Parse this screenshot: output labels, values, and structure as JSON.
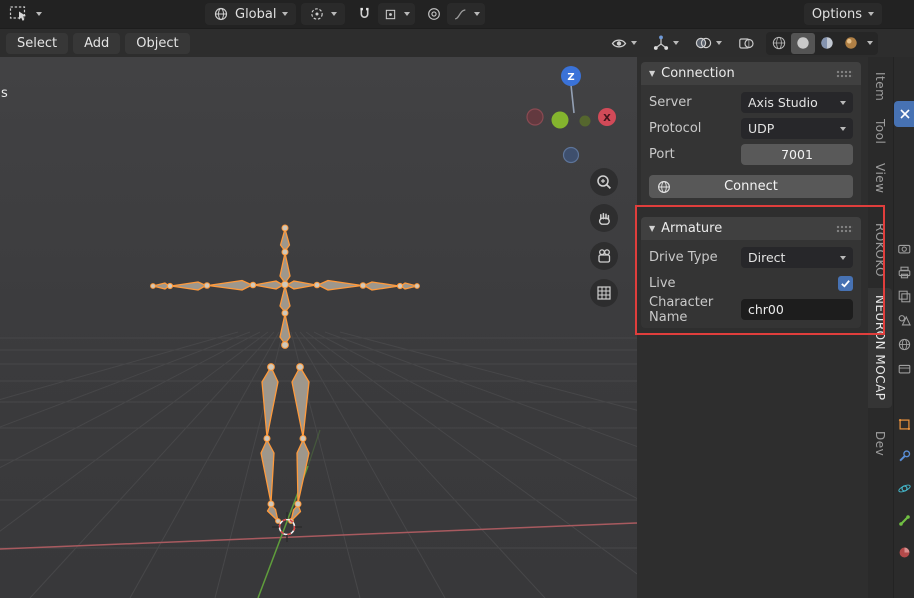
{
  "header": {
    "transform_orientation": "Global",
    "options": "Options"
  },
  "toolbar_menus": [
    "Select",
    "Add",
    "Object"
  ],
  "viewport": {
    "left_edge_label": "s",
    "gizmo_axis_z": "Z",
    "gizmo_axis_x": "X"
  },
  "connection_panel": {
    "title": "Connection",
    "server_label": "Server",
    "server_value": "Axis Studio",
    "protocol_label": "Protocol",
    "protocol_value": "UDP",
    "port_label": "Port",
    "port_value": "7001",
    "connect_button": "Connect"
  },
  "armature_panel": {
    "title": "Armature",
    "drive_type_label": "Drive Type",
    "drive_type_value": "Direct",
    "live_label": "Live",
    "live_checked": true,
    "character_name_label": "Character Name",
    "character_name_value": "chr00"
  },
  "sidebar_tabs": [
    "Item",
    "Tool",
    "View",
    "ROKOKO",
    "NEURON MOCAP",
    "Dev"
  ],
  "active_sidebar_tab": "NEURON MOCAP",
  "colors": {
    "accent": "#4772b3",
    "annotation": "#e03e3c",
    "armature_selected": "#ff9a3c",
    "axis_x": "#a85a5f",
    "axis_y": "#5f9d3c"
  }
}
